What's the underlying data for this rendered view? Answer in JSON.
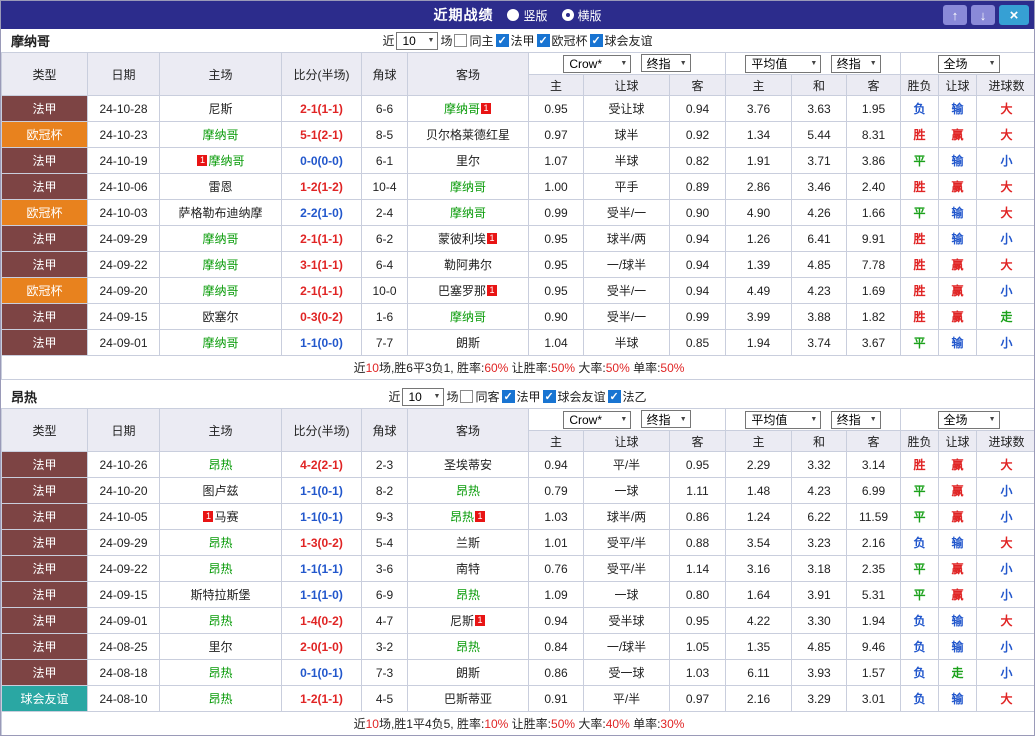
{
  "palette": {
    "win": "#e02424",
    "draw": "#1ba11b",
    "lose": "#2257cc",
    "法甲": "#7d4444",
    "欧冠杯": "#e8821e",
    "球会友谊": "#2aa7a3"
  },
  "titlebar": {
    "title": "近期战绩",
    "radios": [
      {
        "label": "竖版",
        "selected": false
      },
      {
        "label": "横版",
        "selected": true
      }
    ],
    "buttons": {
      "up": "↑",
      "down": "↓",
      "close": "×"
    }
  },
  "table_headers": {
    "type": "类型",
    "date": "日期",
    "home": "主场",
    "score": "比分(半场)",
    "corner": "角球",
    "away": "客场",
    "odds_home": "主",
    "odds_handicap": "让球",
    "odds_away": "客",
    "avg_home": "主",
    "avg_draw": "和",
    "avg_away": "客",
    "result_wdl": "胜负",
    "result_handicap": "让球",
    "result_goals": "进球数",
    "select_company": "Crow*",
    "select_final1": "终指",
    "select_avg": "平均值",
    "select_final2": "终指",
    "select_fullmatch": "全场"
  },
  "sections": [
    {
      "team": "摩纳哥",
      "filter": {
        "prefix": "近",
        "count": "10",
        "suffix": "场",
        "same": {
          "label": "同主",
          "checked": false
        },
        "leagues": [
          {
            "label": "法甲",
            "checked": true
          },
          {
            "label": "欧冠杯",
            "checked": true
          },
          {
            "label": "球会友谊",
            "checked": true
          }
        ]
      },
      "rows": [
        {
          "league": "法甲",
          "date": "24-10-28",
          "home": "尼斯",
          "home_focus": false,
          "home_card": "",
          "score": "2-1(1-1)",
          "score_color": "red",
          "corner": "6-6",
          "away": "摩纳哥",
          "away_focus": true,
          "away_card": "1",
          "odds": [
            "0.95",
            "受让球",
            "0.94"
          ],
          "avg": [
            "3.76",
            "3.63",
            "1.95"
          ],
          "results": [
            "负",
            "输",
            "大"
          ]
        },
        {
          "league": "欧冠杯",
          "date": "24-10-23",
          "home": "摩纳哥",
          "home_focus": true,
          "home_card": "",
          "score": "5-1(2-1)",
          "score_color": "red",
          "corner": "8-5",
          "away": "贝尔格莱德红星",
          "away_focus": false,
          "away_card": "",
          "odds": [
            "0.97",
            "球半",
            "0.92"
          ],
          "avg": [
            "1.34",
            "5.44",
            "8.31"
          ],
          "results": [
            "胜",
            "赢",
            "大"
          ]
        },
        {
          "league": "法甲",
          "date": "24-10-19",
          "home": "摩纳哥",
          "home_focus": true,
          "home_card": "1",
          "score": "0-0(0-0)",
          "score_color": "blue",
          "corner": "6-1",
          "away": "里尔",
          "away_focus": false,
          "away_card": "",
          "odds": [
            "1.07",
            "半球",
            "0.82"
          ],
          "avg": [
            "1.91",
            "3.71",
            "3.86"
          ],
          "results": [
            "平",
            "输",
            "小"
          ]
        },
        {
          "league": "法甲",
          "date": "24-10-06",
          "home": "雷恩",
          "home_focus": false,
          "home_card": "",
          "score": "1-2(1-2)",
          "score_color": "red",
          "corner": "10-4",
          "away": "摩纳哥",
          "away_focus": true,
          "away_card": "",
          "odds": [
            "1.00",
            "平手",
            "0.89"
          ],
          "avg": [
            "2.86",
            "3.46",
            "2.40"
          ],
          "results": [
            "胜",
            "赢",
            "大"
          ]
        },
        {
          "league": "欧冠杯",
          "date": "24-10-03",
          "home": "萨格勒布迪纳摩",
          "home_focus": false,
          "home_card": "",
          "score": "2-2(1-0)",
          "score_color": "blue",
          "corner": "2-4",
          "away": "摩纳哥",
          "away_focus": true,
          "away_card": "",
          "odds": [
            "0.99",
            "受半/一",
            "0.90"
          ],
          "avg": [
            "4.90",
            "4.26",
            "1.66"
          ],
          "results": [
            "平",
            "输",
            "大"
          ]
        },
        {
          "league": "法甲",
          "date": "24-09-29",
          "home": "摩纳哥",
          "home_focus": true,
          "home_card": "",
          "score": "2-1(1-1)",
          "score_color": "red",
          "corner": "6-2",
          "away": "蒙彼利埃",
          "away_focus": false,
          "away_card": "1",
          "odds": [
            "0.95",
            "球半/两",
            "0.94"
          ],
          "avg": [
            "1.26",
            "6.41",
            "9.91"
          ],
          "results": [
            "胜",
            "输",
            "小"
          ]
        },
        {
          "league": "法甲",
          "date": "24-09-22",
          "home": "摩纳哥",
          "home_focus": true,
          "home_card": "",
          "score": "3-1(1-1)",
          "score_color": "red",
          "corner": "6-4",
          "away": "勒阿弗尔",
          "away_focus": false,
          "away_card": "",
          "odds": [
            "0.95",
            "一/球半",
            "0.94"
          ],
          "avg": [
            "1.39",
            "4.85",
            "7.78"
          ],
          "results": [
            "胜",
            "赢",
            "大"
          ]
        },
        {
          "league": "欧冠杯",
          "date": "24-09-20",
          "home": "摩纳哥",
          "home_focus": true,
          "home_card": "",
          "score": "2-1(1-1)",
          "score_color": "red",
          "corner": "10-0",
          "away": "巴塞罗那",
          "away_focus": false,
          "away_card": "1",
          "odds": [
            "0.95",
            "受半/一",
            "0.94"
          ],
          "avg": [
            "4.49",
            "4.23",
            "1.69"
          ],
          "results": [
            "胜",
            "赢",
            "小"
          ]
        },
        {
          "league": "法甲",
          "date": "24-09-15",
          "home": "欧塞尔",
          "home_focus": false,
          "home_card": "",
          "score": "0-3(0-2)",
          "score_color": "red",
          "corner": "1-6",
          "away": "摩纳哥",
          "away_focus": true,
          "away_card": "",
          "odds": [
            "0.90",
            "受半/一",
            "0.99"
          ],
          "avg": [
            "3.99",
            "3.88",
            "1.82"
          ],
          "results": [
            "胜",
            "赢",
            "走"
          ]
        },
        {
          "league": "法甲",
          "date": "24-09-01",
          "home": "摩纳哥",
          "home_focus": true,
          "home_card": "",
          "score": "1-1(0-0)",
          "score_color": "blue",
          "corner": "7-7",
          "away": "朗斯",
          "away_focus": false,
          "away_card": "",
          "odds": [
            "1.04",
            "半球",
            "0.85"
          ],
          "avg": [
            "1.94",
            "3.74",
            "3.67"
          ],
          "results": [
            "平",
            "输",
            "小"
          ]
        }
      ],
      "summary": [
        {
          "t": "近"
        },
        {
          "t": "10",
          "red": true
        },
        {
          "t": "场,胜6平3负1, 胜率:"
        },
        {
          "t": "60%",
          "red": true
        },
        {
          "t": " 让胜率:"
        },
        {
          "t": "50%",
          "red": true
        },
        {
          "t": " 大率:"
        },
        {
          "t": "50%",
          "red": true
        },
        {
          "t": " 单率:"
        },
        {
          "t": "50%",
          "red": true
        }
      ]
    },
    {
      "team": "昂热",
      "filter": {
        "prefix": "近",
        "count": "10",
        "suffix": "场",
        "same": {
          "label": "同客",
          "checked": false
        },
        "leagues": [
          {
            "label": "法甲",
            "checked": true
          },
          {
            "label": "球会友谊",
            "checked": true
          },
          {
            "label": "法乙",
            "checked": true
          }
        ]
      },
      "rows": [
        {
          "league": "法甲",
          "date": "24-10-26",
          "home": "昂热",
          "home_focus": true,
          "home_card": "",
          "score": "4-2(2-1)",
          "score_color": "red",
          "corner": "2-3",
          "away": "圣埃蒂安",
          "away_focus": false,
          "away_card": "",
          "odds": [
            "0.94",
            "平/半",
            "0.95"
          ],
          "avg": [
            "2.29",
            "3.32",
            "3.14"
          ],
          "results": [
            "胜",
            "赢",
            "大"
          ]
        },
        {
          "league": "法甲",
          "date": "24-10-20",
          "home": "图卢兹",
          "home_focus": false,
          "home_card": "",
          "score": "1-1(0-1)",
          "score_color": "blue",
          "corner": "8-2",
          "away": "昂热",
          "away_focus": true,
          "away_card": "",
          "odds": [
            "0.79",
            "一球",
            "1.11"
          ],
          "avg": [
            "1.48",
            "4.23",
            "6.99"
          ],
          "results": [
            "平",
            "赢",
            "小"
          ]
        },
        {
          "league": "法甲",
          "date": "24-10-05",
          "home": "马赛",
          "home_focus": false,
          "home_card": "1",
          "score": "1-1(0-1)",
          "score_color": "blue",
          "corner": "9-3",
          "away": "昂热",
          "away_focus": true,
          "away_card": "1",
          "odds": [
            "1.03",
            "球半/两",
            "0.86"
          ],
          "avg": [
            "1.24",
            "6.22",
            "11.59"
          ],
          "results": [
            "平",
            "赢",
            "小"
          ]
        },
        {
          "league": "法甲",
          "date": "24-09-29",
          "home": "昂热",
          "home_focus": true,
          "home_card": "",
          "score": "1-3(0-2)",
          "score_color": "red",
          "corner": "5-4",
          "away": "兰斯",
          "away_focus": false,
          "away_card": "",
          "odds": [
            "1.01",
            "受平/半",
            "0.88"
          ],
          "avg": [
            "3.54",
            "3.23",
            "2.16"
          ],
          "results": [
            "负",
            "输",
            "大"
          ]
        },
        {
          "league": "法甲",
          "date": "24-09-22",
          "home": "昂热",
          "home_focus": true,
          "home_card": "",
          "score": "1-1(1-1)",
          "score_color": "blue",
          "corner": "3-6",
          "away": "南特",
          "away_focus": false,
          "away_card": "",
          "odds": [
            "0.76",
            "受平/半",
            "1.14"
          ],
          "avg": [
            "3.16",
            "3.18",
            "2.35"
          ],
          "results": [
            "平",
            "赢",
            "小"
          ]
        },
        {
          "league": "法甲",
          "date": "24-09-15",
          "home": "斯特拉斯堡",
          "home_focus": false,
          "home_card": "",
          "score": "1-1(1-0)",
          "score_color": "blue",
          "corner": "6-9",
          "away": "昂热",
          "away_focus": true,
          "away_card": "",
          "odds": [
            "1.09",
            "一球",
            "0.80"
          ],
          "avg": [
            "1.64",
            "3.91",
            "5.31"
          ],
          "results": [
            "平",
            "赢",
            "小"
          ]
        },
        {
          "league": "法甲",
          "date": "24-09-01",
          "home": "昂热",
          "home_focus": true,
          "home_card": "",
          "score": "1-4(0-2)",
          "score_color": "red",
          "corner": "4-7",
          "away": "尼斯",
          "away_focus": false,
          "away_card": "1",
          "odds": [
            "0.94",
            "受半球",
            "0.95"
          ],
          "avg": [
            "4.22",
            "3.30",
            "1.94"
          ],
          "results": [
            "负",
            "输",
            "大"
          ]
        },
        {
          "league": "法甲",
          "date": "24-08-25",
          "home": "里尔",
          "home_focus": false,
          "home_card": "",
          "score": "2-0(1-0)",
          "score_color": "red",
          "corner": "3-2",
          "away": "昂热",
          "away_focus": true,
          "away_card": "",
          "odds": [
            "0.84",
            "一/球半",
            "1.05"
          ],
          "avg": [
            "1.35",
            "4.85",
            "9.46"
          ],
          "results": [
            "负",
            "输",
            "小"
          ]
        },
        {
          "league": "法甲",
          "date": "24-08-18",
          "home": "昂热",
          "home_focus": true,
          "home_card": "",
          "score": "0-1(0-1)",
          "score_color": "blue",
          "corner": "7-3",
          "away": "朗斯",
          "away_focus": false,
          "away_card": "",
          "odds": [
            "0.86",
            "受一球",
            "1.03"
          ],
          "avg": [
            "6.11",
            "3.93",
            "1.57"
          ],
          "results": [
            "负",
            "走",
            "小"
          ]
        },
        {
          "league": "球会友谊",
          "date": "24-08-10",
          "home": "昂热",
          "home_focus": true,
          "home_card": "",
          "score": "1-2(1-1)",
          "score_color": "red",
          "corner": "4-5",
          "away": "巴斯蒂亚",
          "away_focus": false,
          "away_card": "",
          "odds": [
            "0.91",
            "平/半",
            "0.97"
          ],
          "avg": [
            "2.16",
            "3.29",
            "3.01"
          ],
          "results": [
            "负",
            "输",
            "大"
          ]
        }
      ],
      "summary": [
        {
          "t": "近"
        },
        {
          "t": "10",
          "red": true
        },
        {
          "t": "场,胜1平4负5, 胜率:"
        },
        {
          "t": "10%",
          "red": true
        },
        {
          "t": " 让胜率:"
        },
        {
          "t": "50%",
          "red": true
        },
        {
          "t": " 大率:"
        },
        {
          "t": "40%",
          "red": true
        },
        {
          "t": " 单率:"
        },
        {
          "t": "30%",
          "red": true
        }
      ]
    }
  ]
}
